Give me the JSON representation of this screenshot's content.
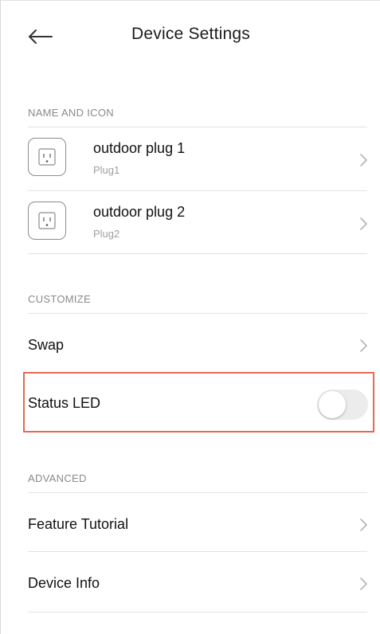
{
  "header": {
    "title": "Device Settings",
    "back_icon": "arrow-left-icon"
  },
  "sections": {
    "name_and_icon": {
      "label": "NAME AND ICON",
      "devices": [
        {
          "name": "outdoor plug 1",
          "sub": "Plug1",
          "icon": "outlet-icon"
        },
        {
          "name": "outdoor plug 2",
          "sub": "Plug2",
          "icon": "outlet-icon"
        }
      ]
    },
    "customize": {
      "label": "CUSTOMIZE",
      "swap_label": "Swap",
      "status_led_label": "Status LED",
      "status_led_on": false
    },
    "advanced": {
      "label": "ADVANCED",
      "items": [
        {
          "label": "Feature Tutorial"
        },
        {
          "label": "Device Info"
        }
      ]
    }
  },
  "colors": {
    "highlight_border": "#e46956",
    "toggle_off_track": "#ececec",
    "section_label": "#8a8a8a",
    "subtitle": "#a0a0a0"
  }
}
